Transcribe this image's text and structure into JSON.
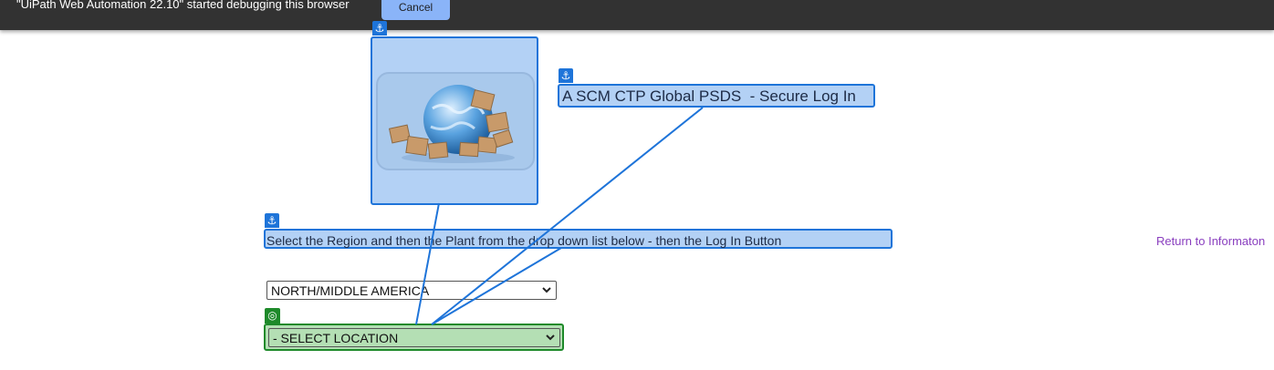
{
  "debug_bar": {
    "message": "\"UiPath Web Automation 22.10\" started debugging this browser",
    "cancel_label": "Cancel"
  },
  "page": {
    "title": "A SCM CTP Global PSDS  - Secure Log In",
    "instructions": "Select the Region and then the Plant from the drop down list below - then the Log In Button",
    "return_link": "Return to Informaton",
    "region_select": {
      "selected": "NORTH/MIDDLE AMERICA"
    },
    "location_select": {
      "selected": "- SELECT LOCATION"
    }
  },
  "overlay": {
    "anchor_icon": "anchor-icon",
    "target_icon": "target-icon",
    "anchor_glyph": "⚓",
    "target_glyph": "◎",
    "colors": {
      "anchor": "#1e74d9",
      "anchor_fill": "#b3d1f5",
      "target": "#1e8a2a",
      "target_fill": "#b4dfb4"
    }
  },
  "icons": {
    "chevron": "chevron-down-icon",
    "logo": "globe-boxes-logo"
  }
}
